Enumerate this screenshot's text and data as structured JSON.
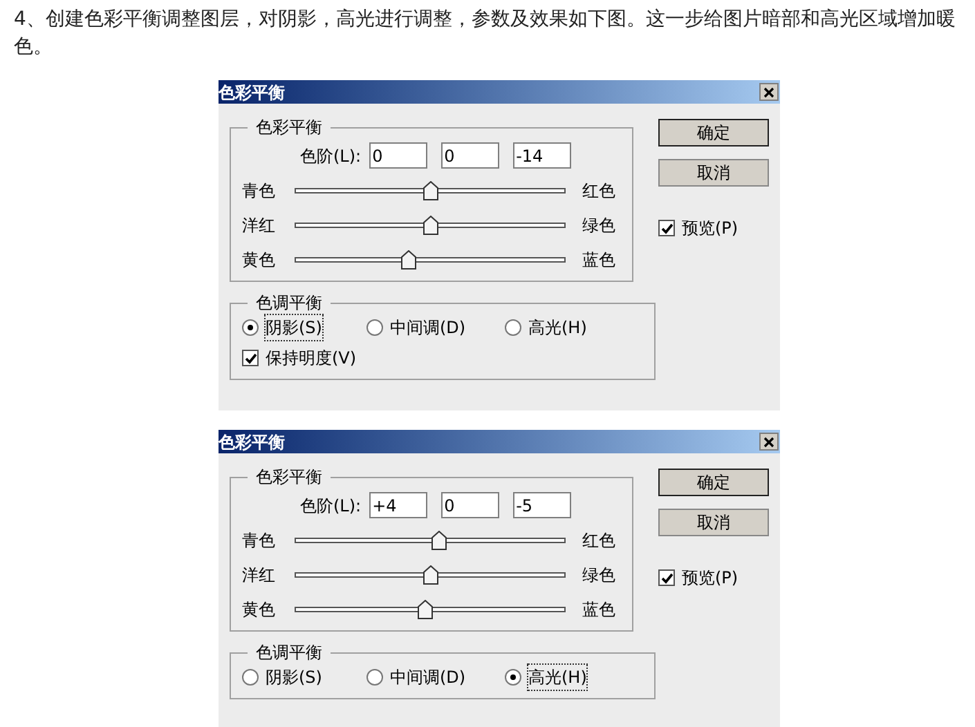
{
  "intro": "4、创建色彩平衡调整图层，对阴影，高光进行调整，参数及效果如下图。这一步给图片暗部和高光区域增加暖色。",
  "dialogs": [
    {
      "title": "色彩平衡",
      "color_group": {
        "title": "色彩平衡",
        "levels_label": "色阶(L):",
        "levels": [
          "0",
          "0",
          "-14"
        ],
        "sliders": [
          {
            "left": "青色",
            "right": "红色",
            "level": 0.5
          },
          {
            "left": "洋红",
            "right": "绿色",
            "level": 0.5
          },
          {
            "left": "黄色",
            "right": "蓝色",
            "level": 0.42
          }
        ]
      },
      "tone_group": {
        "title": "色调平衡",
        "options": [
          {
            "label": "阴影(S)",
            "selected": true
          },
          {
            "label": "中间调(D)",
            "selected": false
          },
          {
            "label": "高光(H)",
            "selected": false
          }
        ],
        "preserve": {
          "label": "保持明度(V)",
          "checked": true
        }
      },
      "buttons": [
        "确定",
        "取消"
      ],
      "preview": {
        "label": "预览(P)",
        "checked": true
      }
    },
    {
      "title": "色彩平衡",
      "color_group": {
        "title": "色彩平衡",
        "levels_label": "色阶(L):",
        "levels": [
          "+4",
          "0",
          "-5"
        ],
        "sliders": [
          {
            "left": "青色",
            "right": "红色",
            "level": 0.53
          },
          {
            "left": "洋红",
            "right": "绿色",
            "level": 0.5
          },
          {
            "left": "黄色",
            "right": "蓝色",
            "level": 0.48
          }
        ]
      },
      "tone_group": {
        "title": "色调平衡",
        "options": [
          {
            "label": "阴影(S)",
            "selected": false
          },
          {
            "label": "中间调(D)",
            "selected": false
          },
          {
            "label": "高光(H)",
            "selected": true
          }
        ]
      },
      "buttons": [
        "确定",
        "取消"
      ],
      "preview": {
        "label": "预览(P)",
        "checked": true
      }
    }
  ]
}
